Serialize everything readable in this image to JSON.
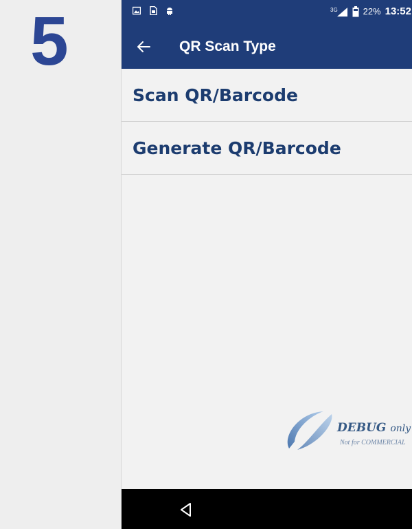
{
  "step": {
    "number": "5"
  },
  "status_bar": {
    "left_icons": [
      "image-icon",
      "sim-card-icon",
      "android-icon"
    ],
    "signal_label": "3G",
    "battery_percent": "22%",
    "time": "13:52"
  },
  "app_bar": {
    "back_icon": "arrow-left-icon",
    "title": "QR Scan Type"
  },
  "menu": {
    "items": [
      {
        "label": "Scan QR/Barcode"
      },
      {
        "label": "Generate QR/Barcode"
      }
    ]
  },
  "watermark": {
    "debug_text": "DEBUG",
    "only_text": "only",
    "commercial_text": "Not for COMMERCIAL"
  },
  "nav_bar": {
    "back_icon": "triangle-back-icon"
  },
  "colors": {
    "primary": "#1f3d79",
    "step_number": "#2c4694",
    "menu_text": "#1c3c6f",
    "background": "#f2f2f2"
  }
}
